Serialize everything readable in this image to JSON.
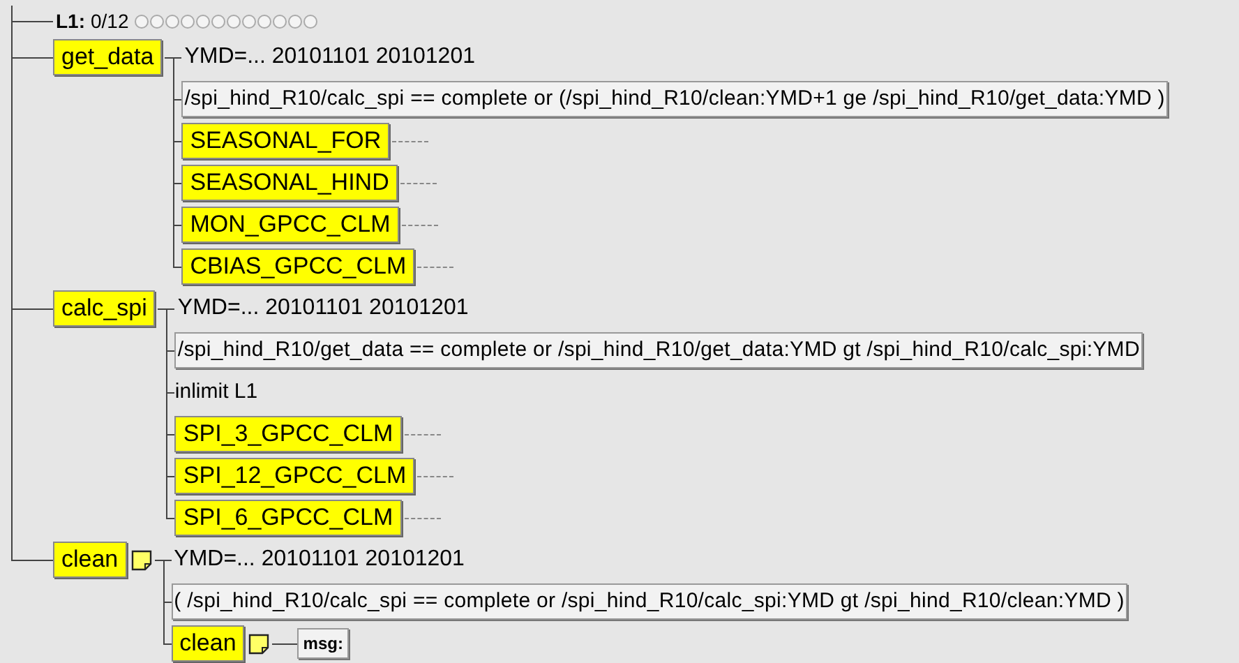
{
  "limit": {
    "name": "L1:",
    "value": "0/12"
  },
  "nodes": [
    {
      "kind": "task",
      "name": "get_data",
      "note": false,
      "children": [
        {
          "kind": "variable",
          "text": "YMD=... 20101101 20101201"
        },
        {
          "kind": "trigger",
          "text": "/spi_hind_R10/calc_spi == complete or (/spi_hind_R10/clean:YMD+1 ge /spi_hind_R10/get_data:YMD )"
        },
        {
          "kind": "task",
          "name": "SEASONAL_FOR",
          "note": false
        },
        {
          "kind": "task",
          "name": "SEASONAL_HIND",
          "note": false
        },
        {
          "kind": "task",
          "name": "MON_GPCC_CLM",
          "note": false
        },
        {
          "kind": "task",
          "name": "CBIAS_GPCC_CLM",
          "note": false
        }
      ]
    },
    {
      "kind": "task",
      "name": "calc_spi",
      "note": false,
      "children": [
        {
          "kind": "variable",
          "text": "YMD=... 20101101 20101201"
        },
        {
          "kind": "trigger",
          "text": "/spi_hind_R10/get_data == complete or /spi_hind_R10/get_data:YMD gt /spi_hind_R10/calc_spi:YMD"
        },
        {
          "kind": "inlimit",
          "text": "inlimit L1"
        },
        {
          "kind": "task",
          "name": "SPI_3_GPCC_CLM",
          "note": false
        },
        {
          "kind": "task",
          "name": "SPI_12_GPCC_CLM",
          "note": false
        },
        {
          "kind": "task",
          "name": "SPI_6_GPCC_CLM",
          "note": false
        }
      ]
    },
    {
      "kind": "task",
      "name": "clean",
      "note": true,
      "children": [
        {
          "kind": "variable",
          "text": "YMD=... 20101101 20101201"
        },
        {
          "kind": "trigger",
          "text": "( /spi_hind_R10/calc_spi == complete or /spi_hind_R10/calc_spi:YMD gt /spi_hind_R10/clean:YMD )"
        },
        {
          "kind": "task",
          "name": "clean",
          "note": true,
          "children": [
            {
              "kind": "label",
              "text": "msg:"
            }
          ]
        }
      ]
    }
  ]
}
